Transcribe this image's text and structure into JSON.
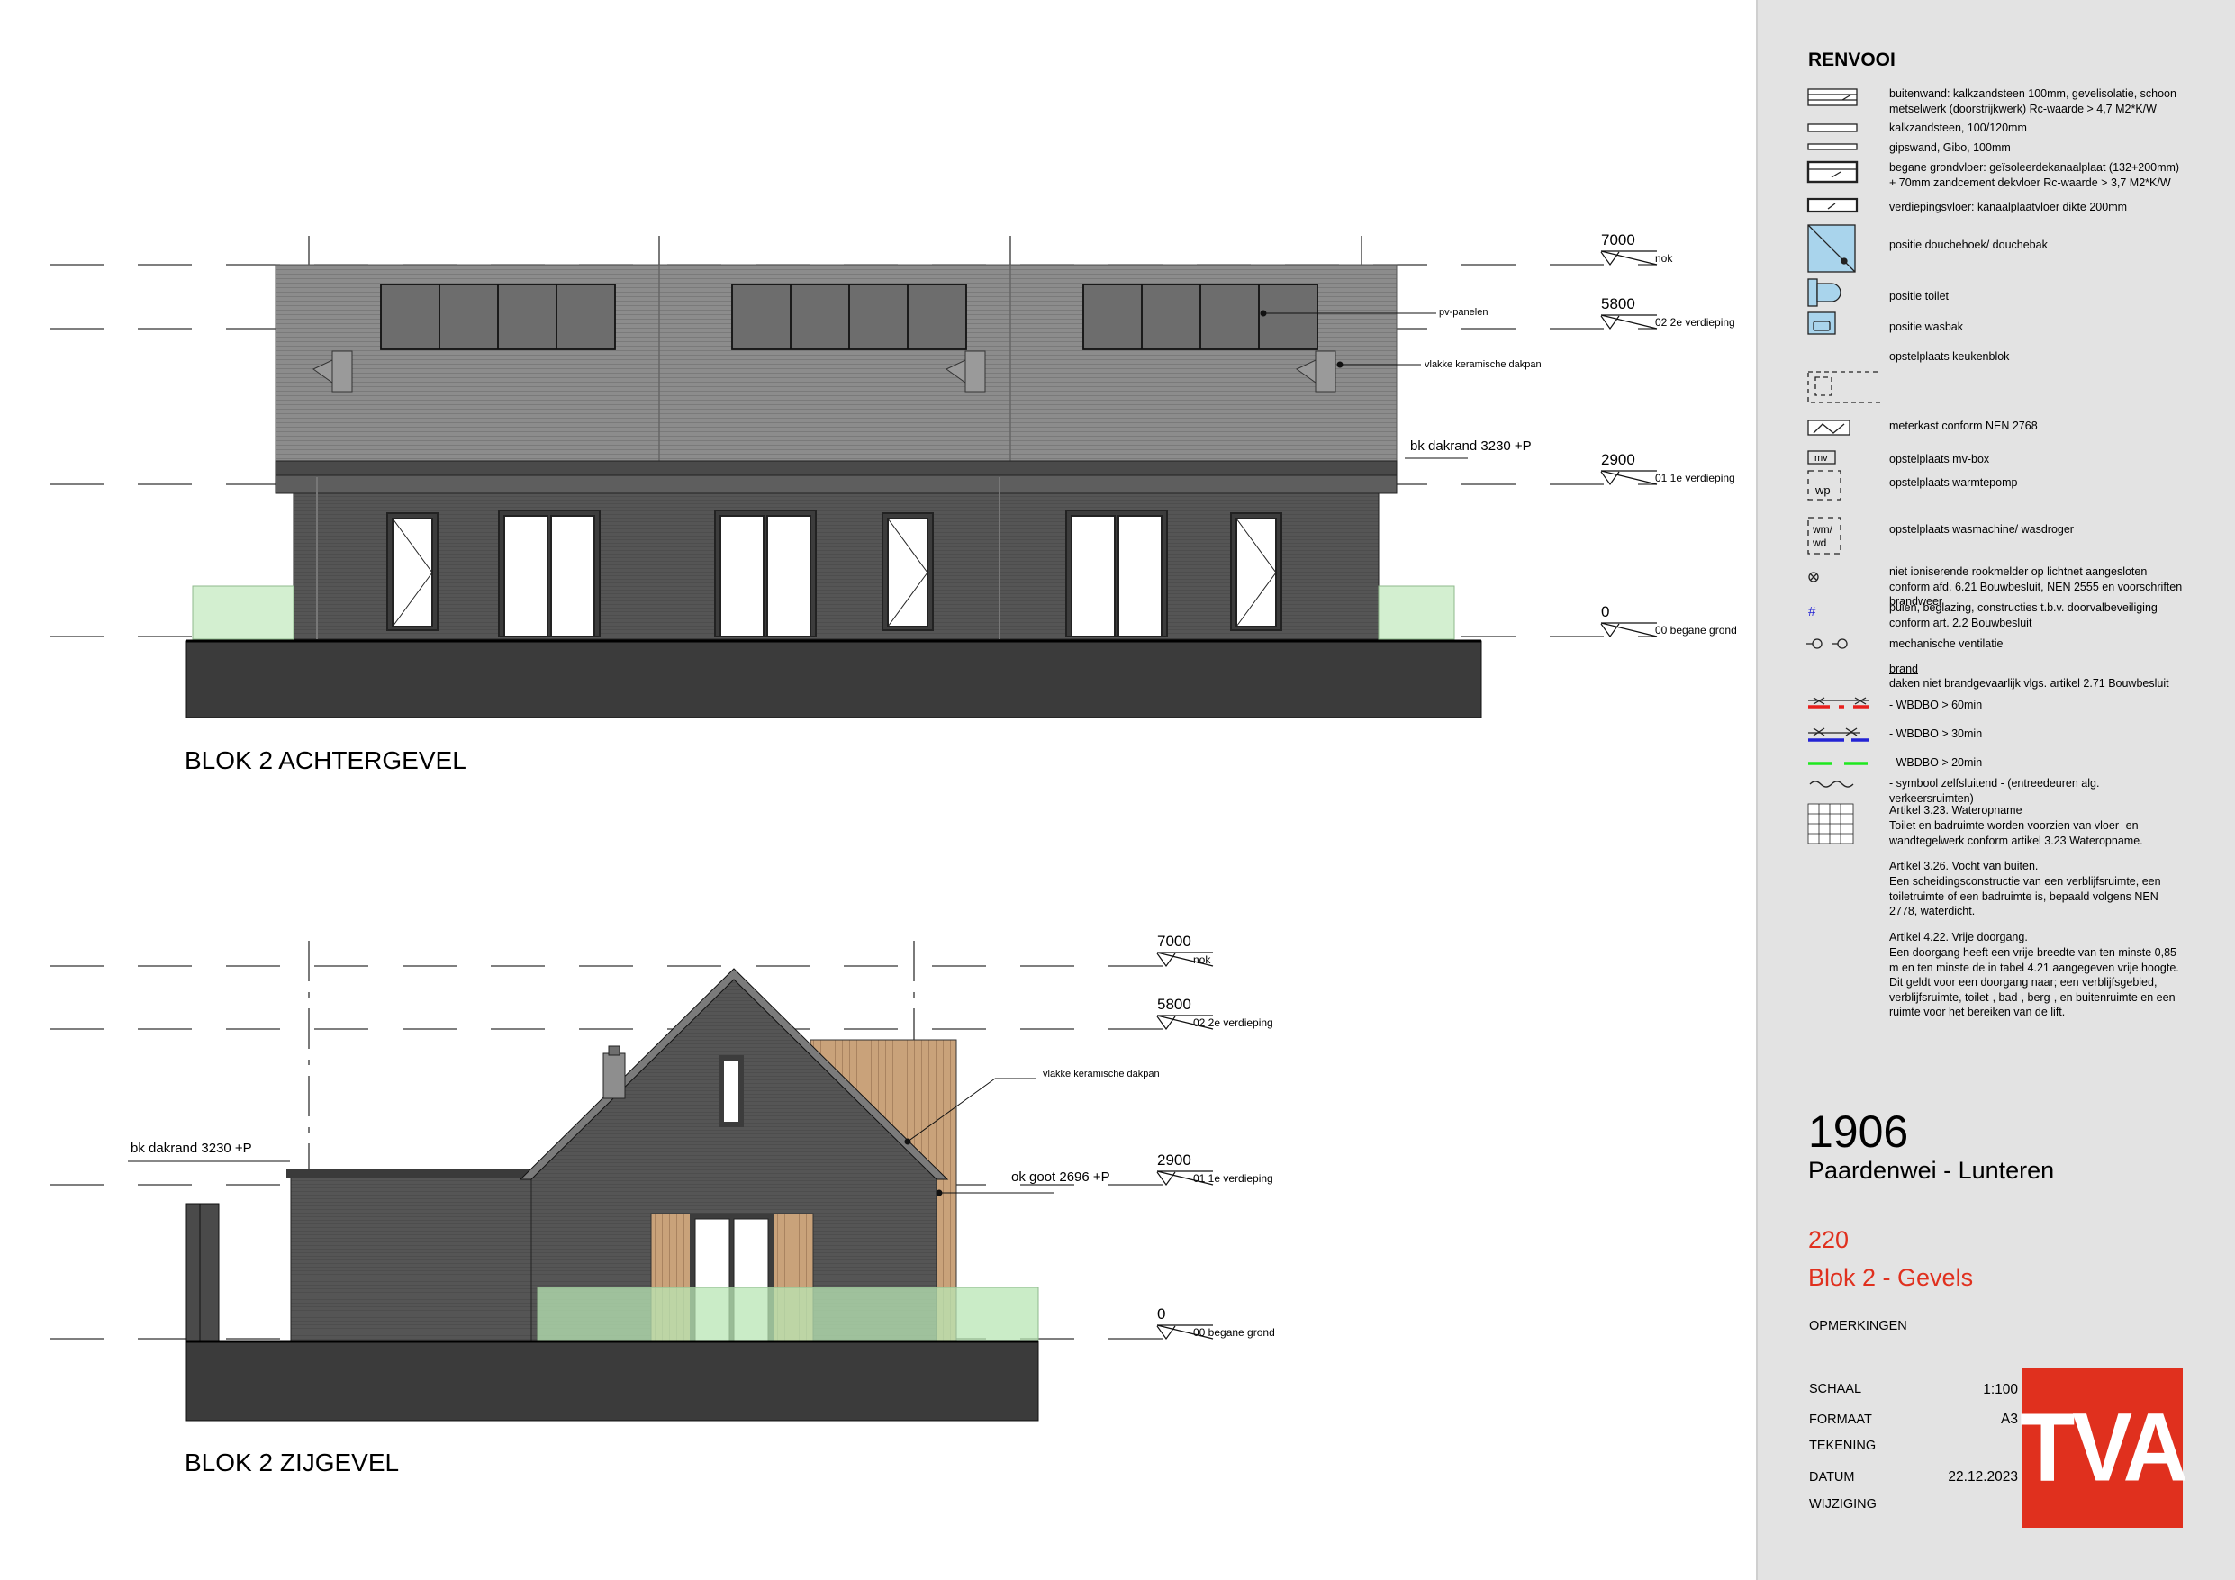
{
  "views": {
    "rear": {
      "title": "BLOK 2 ACHTERGEVEL",
      "levels": [
        {
          "value": "7000",
          "name": "nok"
        },
        {
          "value": "5800",
          "name": "02 2e verdieping"
        },
        {
          "value": "2900",
          "name": "01 1e verdieping"
        },
        {
          "value": "0",
          "name": "00 begane grond"
        }
      ],
      "annotations": {
        "pv": "pv-panelen",
        "roof_tiles": "vlakke keramische dakpan",
        "bk_dakrand": "bk dakrand 3230 +P"
      }
    },
    "side": {
      "title": "BLOK 2 ZIJGEVEL",
      "levels": [
        {
          "value": "7000",
          "name": "nok"
        },
        {
          "value": "5800",
          "name": "02 2e verdieping"
        },
        {
          "value": "2900",
          "name": "01 1e verdieping"
        },
        {
          "value": "0",
          "name": "00 begane grond"
        }
      ],
      "annotations": {
        "roof_tiles": "vlakke keramische dakpan",
        "bk_dakrand": "bk dakrand 3230 +P",
        "ok_goot": "ok goot 2696 +P"
      }
    }
  },
  "legend": {
    "title": "RENVOOI",
    "items": [
      {
        "icon": "buitenwand-symbol",
        "text": "buitenwand: kalkzandsteen 100mm, gevelisolatie, schoon metselwerk (doorstrijkwerk) Rc-waarde > 4,7 M2*K/W"
      },
      {
        "icon": "kalkzandsteen-symbol",
        "text": "kalkzandsteen, 100/120mm"
      },
      {
        "icon": "gipswand-symbol",
        "text": "gipswand, Gibo, 100mm"
      },
      {
        "icon": "grondvloer-symbol",
        "text": "begane grondvloer: geïsoleerdekanaalplaat (132+200mm) + 70mm zandcement dekvloer Rc-waarde > 3,7 M2*K/W"
      },
      {
        "icon": "verdiepingsvloer-symbol",
        "text": "verdiepingsvloer: kanaalplaatvloer dikte 200mm"
      },
      {
        "icon": "douche-symbol",
        "text": "positie douchehoek/ douchebak"
      },
      {
        "icon": "toilet-symbol",
        "text": "positie toilet"
      },
      {
        "icon": "wasbak-symbol",
        "text": "positie wasbak"
      },
      {
        "icon": "keukenblok-symbol",
        "text": "opstelplaats keukenblok"
      },
      {
        "icon": "meterkast-symbol",
        "text": "meterkast conform NEN 2768"
      },
      {
        "icon": "mv-box-symbol",
        "text": "opstelplaats mv-box"
      },
      {
        "icon": "warmtepomp-symbol",
        "text": "opstelplaats warmtepomp"
      },
      {
        "icon": "wasmachine-symbol",
        "text": "opstelplaats wasmachine/ wasdroger"
      },
      {
        "icon": "rookmelder-symbol",
        "text": "niet ioniserende rookmelder op lichtnet aangesloten conform afd. 6.21 Bouwbesluit, NEN 2555 en voorschriften brandweer"
      },
      {
        "icon": "doorvalbeveiliging-symbol",
        "text": "puien, beglazing, constructies t.b.v. doorvalbeveiliging conform art. 2.2 Bouwbesluit"
      },
      {
        "icon": "ventilatie-symbol",
        "text": "mechanische ventilatie"
      }
    ],
    "sym_wp": "wp",
    "sym_wm": "wm/",
    "sym_wd": "wd",
    "sym_mv": "mv",
    "sym_hash": "#",
    "brand_heading": "brand",
    "brand_note": "daken niet brandgevaarlijk vlgs. artikel 2.71 Bouwbesluit",
    "fire_items": [
      {
        "color": "#e8201c",
        "text": "- WBDBO > 60min"
      },
      {
        "color": "#2323d4",
        "text": "- WBDBO > 30min"
      },
      {
        "color": "#1ee81e",
        "text": "- WBDBO > 20min"
      },
      {
        "color": "#000000",
        "text": "- symbool zelfsluitend - (entreedeuren alg. verkeersruimten)"
      }
    ],
    "articles": [
      {
        "title": "Artikel 3.23. Wateropname",
        "text": "Toilet en badruimte worden voorzien van vloer- en wandtegelwerk conform artikel 3.23 Wateropname."
      },
      {
        "title": "Artikel 3.26. Vocht van buiten.",
        "text": "Een scheidingsconstructie van een verblijfsruimte, een toiletruimte of een badruimte is, bepaald volgens NEN 2778, waterdicht."
      },
      {
        "title": "Artikel 4.22. Vrije doorgang.",
        "text": "Een doorgang heeft een vrije breedte van ten minste 0,85 m en ten minste de in tabel 4.21 aangegeven vrije hoogte. Dit geldt voor een doorgang naar; een verblijfsgebied, verblijfsruimte, toilet-, bad-, berg-, en buitenruimte en een ruimte voor het bereiken van de lift."
      }
    ]
  },
  "project": {
    "number": "1906",
    "name": "Paardenwei - Lunteren",
    "drawing_number": "220",
    "drawing_title": "Blok 2 - Gevels",
    "remarks_label": "OPMERKINGEN",
    "fields": [
      {
        "label": "SCHAAL",
        "value": "1:100"
      },
      {
        "label": "FORMAAT",
        "value": "A3"
      },
      {
        "label": "TEKENING",
        "value": ""
      },
      {
        "label": "DATUM",
        "value": "22.12.2023"
      },
      {
        "label": "WIJZIGING",
        "value": ""
      }
    ],
    "logo": "TVA",
    "accent_color": "#e0301e"
  }
}
